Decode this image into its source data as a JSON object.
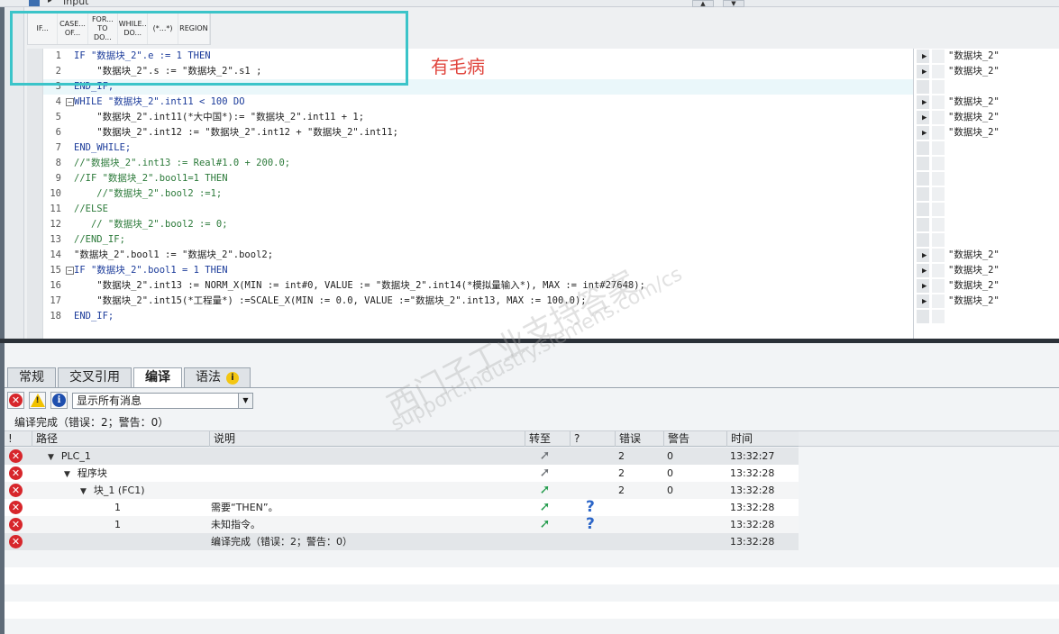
{
  "top_strip": {
    "label": "Input"
  },
  "toolbar": {
    "buttons": [
      {
        "label": "IF..."
      },
      {
        "label": "CASE...\nOF..."
      },
      {
        "label": "FOR...\nTO DO..."
      },
      {
        "label": "WHILE..\nDO..."
      },
      {
        "label": "(*...*)"
      },
      {
        "label": "REGION"
      }
    ]
  },
  "annotation": {
    "text": "有毛病"
  },
  "code": {
    "lines": [
      {
        "n": "1",
        "text": "IF \"数据块_2\".e := 1 THEN"
      },
      {
        "n": "2",
        "text": "    \"数据块_2\".s := \"数据块_2\".s1 ;"
      },
      {
        "n": "3",
        "text": "END_IF;"
      },
      {
        "n": "4",
        "text": "WHILE \"数据块_2\".int11 < 100 DO"
      },
      {
        "n": "5",
        "text": "    \"数据块_2\".int11(*大中国*):= \"数据块_2\".int11 + 1;"
      },
      {
        "n": "6",
        "text": "    \"数据块_2\".int12 := \"数据块_2\".int12 + \"数据块_2\".int11;"
      },
      {
        "n": "7",
        "text": "END_WHILE;"
      },
      {
        "n": "8",
        "text": "//\"数据块_2\".int13 := Real#1.0 + 200.0;"
      },
      {
        "n": "9",
        "text": "//IF \"数据块_2\".bool1=1 THEN"
      },
      {
        "n": "10",
        "text": "    //\"数据块_2\".bool2 :=1;"
      },
      {
        "n": "11",
        "text": "//ELSE"
      },
      {
        "n": "12",
        "text": "   // \"数据块_2\".bool2 := 0;"
      },
      {
        "n": "13",
        "text": "//END_IF;"
      },
      {
        "n": "14",
        "text": "\"数据块_2\".bool1 := \"数据块_2\".bool2;"
      },
      {
        "n": "15",
        "text": "IF \"数据块_2\".bool1 = 1 THEN"
      },
      {
        "n": "16",
        "text": "    \"数据块_2\".int13 := NORM_X(MIN := int#0, VALUE := \"数据块_2\".int14(*模拟量输入*), MAX := int#27648);"
      },
      {
        "n": "17",
        "text": "    \"数据块_2\".int15(*工程量*) :=SCALE_X(MIN := 0.0, VALUE :=\"数据块_2\".int13, MAX := 100.0);"
      },
      {
        "n": "18",
        "text": "END_IF;"
      }
    ]
  },
  "xref": {
    "rows": [
      {
        "text": "\"数据块_2\""
      },
      {
        "text": "\"数据块_2\""
      },
      {
        "text": ""
      },
      {
        "text": "\"数据块_2\""
      },
      {
        "text": "\"数据块_2\""
      },
      {
        "text": "\"数据块_2\""
      },
      {
        "text": ""
      },
      {
        "text": ""
      },
      {
        "text": ""
      },
      {
        "text": ""
      },
      {
        "text": ""
      },
      {
        "text": ""
      },
      {
        "text": ""
      },
      {
        "text": "\"数据块_2\""
      },
      {
        "text": "\"数据块_2\""
      },
      {
        "text": "\"数据块_2\""
      },
      {
        "text": "\"数据块_2\""
      },
      {
        "text": ""
      }
    ]
  },
  "inspector": {
    "tabs": [
      {
        "label": "常规"
      },
      {
        "label": "交叉引用"
      },
      {
        "label": "编译"
      },
      {
        "label": "语法"
      }
    ],
    "filter": {
      "value": "显示所有消息"
    },
    "summary": "编译完成（错误：2；警告：0）",
    "columns": [
      "!",
      "路径",
      "说明",
      "转至",
      "?",
      "错误",
      "警告",
      "时间"
    ],
    "rows": [
      {
        "path": "PLC_1",
        "desc": "",
        "goto": "gray",
        "help": false,
        "errors": "2",
        "warnings": "0",
        "time": "13:32:27"
      },
      {
        "path": "程序块",
        "desc": "",
        "goto": "gray",
        "help": false,
        "errors": "2",
        "warnings": "0",
        "time": "13:32:28"
      },
      {
        "path": "块_1 (FC1)",
        "desc": "",
        "goto": "green",
        "help": false,
        "errors": "2",
        "warnings": "0",
        "time": "13:32:28"
      },
      {
        "path": "1",
        "desc": "需要“THEN”。",
        "goto": "green",
        "help": true,
        "errors": "",
        "warnings": "",
        "time": "13:32:28"
      },
      {
        "path": "1",
        "desc": "未知指令。",
        "goto": "green",
        "help": true,
        "errors": "",
        "warnings": "",
        "time": "13:32:28"
      },
      {
        "path": "",
        "desc": "编译完成（错误：2；警告：0）",
        "goto": "",
        "help": false,
        "errors": "",
        "warnings": "",
        "time": "13:32:28"
      }
    ]
  },
  "icons": {
    "error": "error-icon",
    "warning": "warning-icon",
    "info": "info-icon",
    "goto": "goto-arrow-icon",
    "help": "help-icon"
  },
  "colors": {
    "annotation_box": "#3bc4c9",
    "annotation_text": "#e0453d",
    "keyword": "#1b3b9a",
    "comment": "#2c7a3a",
    "error": "#d7262b"
  }
}
